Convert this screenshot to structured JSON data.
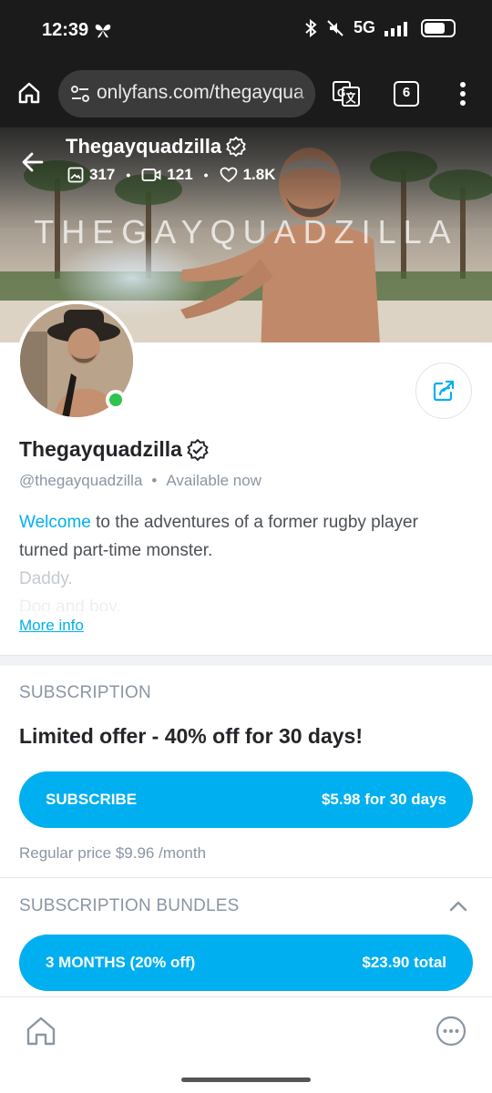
{
  "status_bar": {
    "time": "12:39",
    "network": "5G",
    "battery_level": 0.75,
    "icons": [
      "butterfly-icon",
      "bluetooth-icon",
      "mute-icon",
      "signal-icon",
      "battery-icon"
    ]
  },
  "browser": {
    "url": "onlyfans.com/thegayqua",
    "tab_count": "6"
  },
  "cover": {
    "title": "Thegayquadzilla",
    "watermark": "THEGAYQUADZILLA",
    "stats": {
      "photos": "317",
      "videos": "121",
      "likes": "1.8K"
    }
  },
  "profile": {
    "name": "Thegayquadzilla",
    "handle": "@thegayquadzilla",
    "availability": "Available now",
    "bio": {
      "accent": "Welcome",
      "line1_rest": " to the adventures of a former rugby player",
      "line2": "turned part-time monster.",
      "line3": "Daddy.",
      "line4": "Dog and boy."
    },
    "more_info": "More info"
  },
  "subscription": {
    "heading": "SUBSCRIPTION",
    "offer_title": "Limited offer - 40% off for 30 days!",
    "button_label": "SUBSCRIBE",
    "button_price": "$5.98 for 30 days",
    "regular_price": "Regular price $9.96 /month"
  },
  "bundles": {
    "heading": "SUBSCRIPTION BUNDLES",
    "items": [
      {
        "label": "3 MONTHS (20% off)",
        "price": "$23.90 total"
      }
    ]
  },
  "colors": {
    "accent": "#00aff0",
    "muted": "#8a96a3",
    "online": "#2ec44f",
    "dark_bar": "#1b1b1b"
  }
}
